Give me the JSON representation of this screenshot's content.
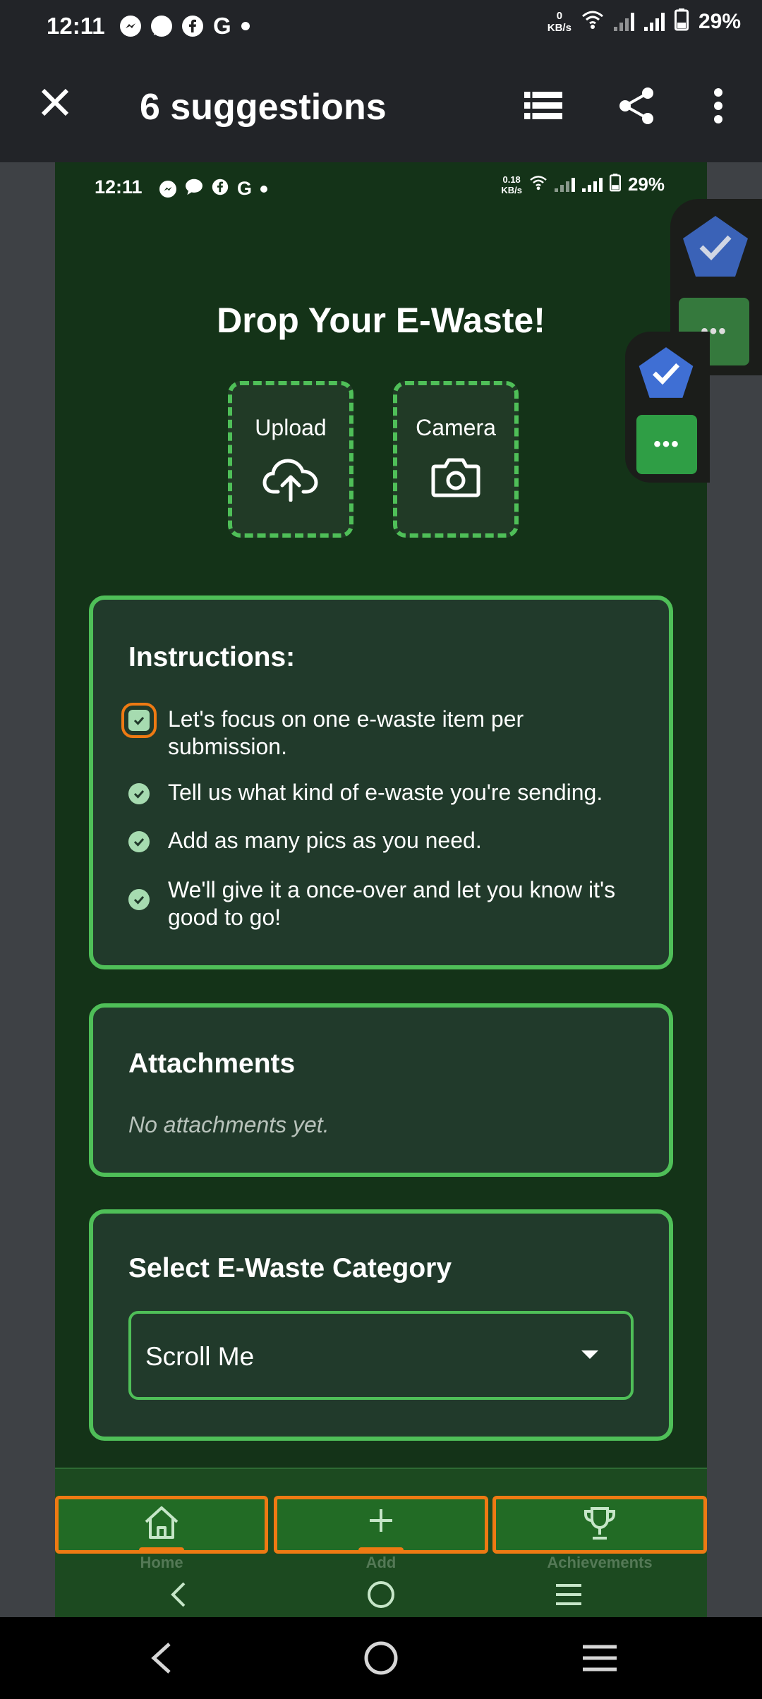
{
  "outer_status": {
    "time": "12:11",
    "net_speed_value": "0",
    "net_speed_unit": "KB/s",
    "battery": "29%",
    "notification_icons": [
      "messenger-icon",
      "chat-icon",
      "facebook-icon",
      "google-icon"
    ]
  },
  "app_bar": {
    "title": "6 suggestions"
  },
  "inner_status": {
    "time": "12:11",
    "net_speed_value": "0.18",
    "net_speed_unit": "KB/s",
    "battery": "29%"
  },
  "page": {
    "heading": "Drop Your E-Waste!",
    "upload_label": "Upload",
    "camera_label": "Camera"
  },
  "instructions": {
    "title": "Instructions:",
    "items": [
      "Let's focus on one e-waste item per submission.",
      "Tell us what kind of e-waste you're sending.",
      "Add as many pics as you need.",
      "We'll give it a once-over and let you know it's good to go!"
    ]
  },
  "attachments": {
    "title": "Attachments",
    "empty_text": "No attachments yet."
  },
  "category": {
    "title": "Select E-Waste Category",
    "selected": "Scroll Me"
  },
  "bottom_nav": {
    "items": [
      {
        "label": "Home",
        "icon": "home-icon"
      },
      {
        "label": "Add",
        "icon": "plus-icon"
      },
      {
        "label": "Achievements",
        "icon": "trophy-icon"
      }
    ]
  },
  "overlay": {
    "more_label": "•••"
  },
  "colors": {
    "background": "#143318",
    "card": "#213a2b",
    "accent_green": "#4fbf58",
    "focus_orange": "#ee7a13",
    "nav_green": "#226b25",
    "overlay_blue": "#3f6fd4"
  }
}
